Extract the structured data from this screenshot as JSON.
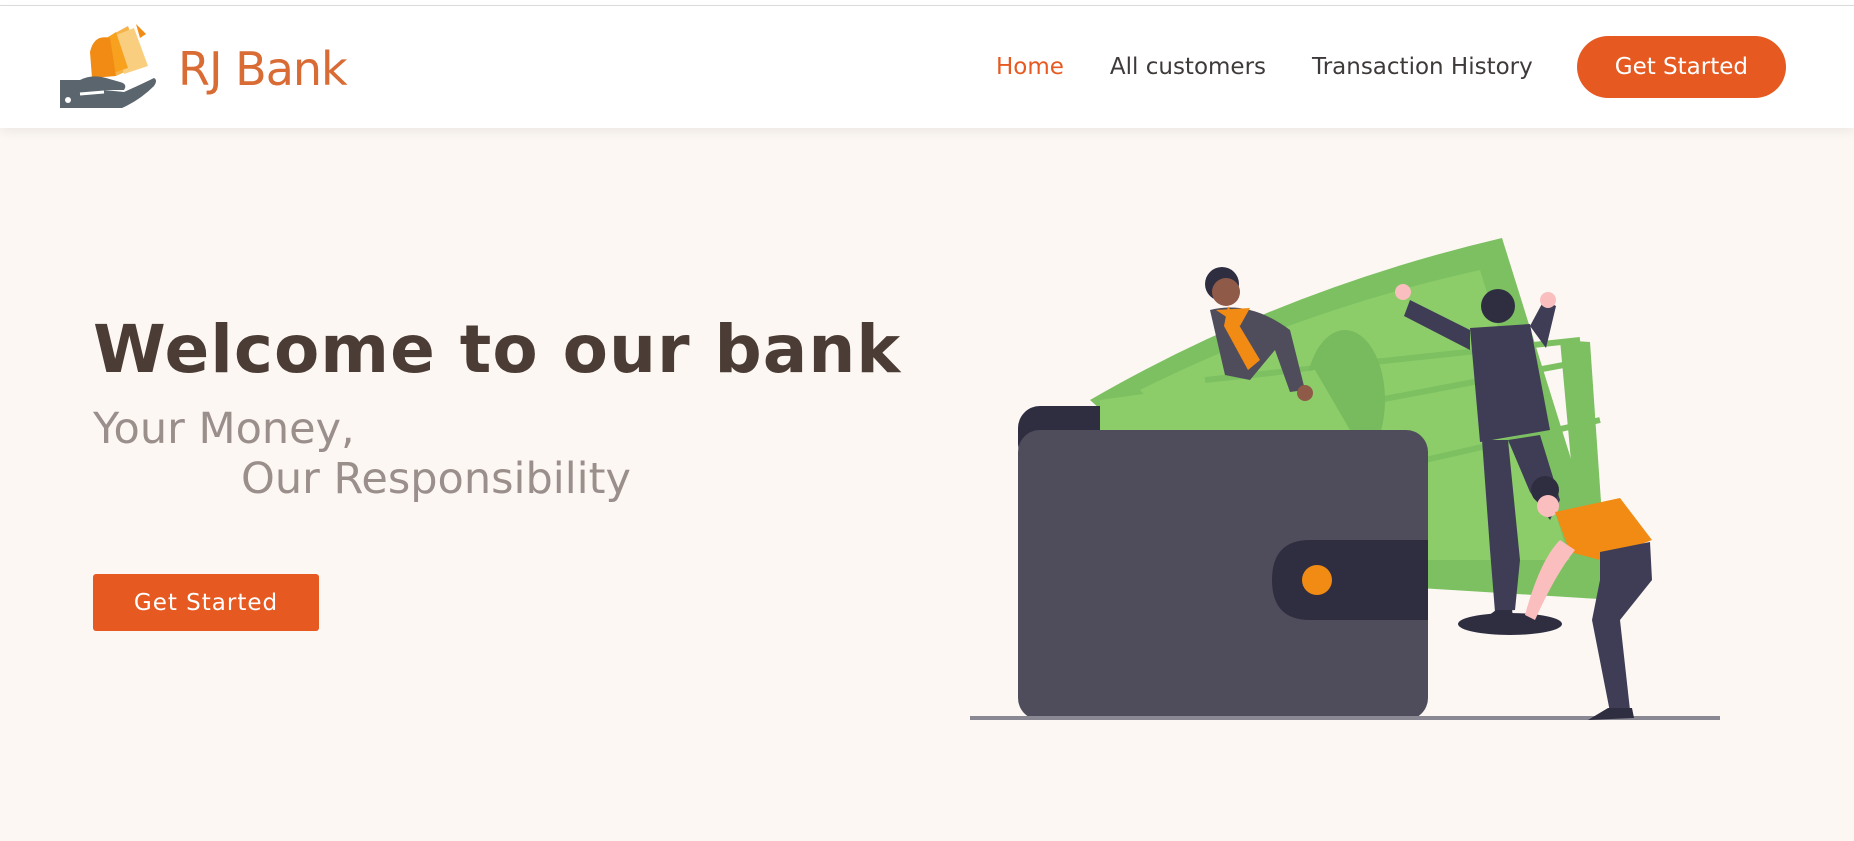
{
  "brand": {
    "name": "RJ Bank",
    "logo_icon": "hand-holding-money-icon",
    "color": "#d96b35"
  },
  "nav": {
    "links": [
      {
        "label": "Home",
        "active": true
      },
      {
        "label": "All customers",
        "active": false
      },
      {
        "label": "Transaction History",
        "active": false
      }
    ],
    "cta_label": "Get Started"
  },
  "hero": {
    "title": "Welcome to our bank",
    "subtitle_line1": "Your Money,",
    "subtitle_line2": "Our Responsibility",
    "cta_label": "Get Started",
    "illustration": "wallet-with-money-people-illustration"
  },
  "colors": {
    "accent": "#e65a22",
    "page_background": "#fcf7f3",
    "title": "#4b3d35",
    "subtitle": "#9b8f8b",
    "wallet": "#4f4d5c",
    "money": "#8ccd6a"
  }
}
